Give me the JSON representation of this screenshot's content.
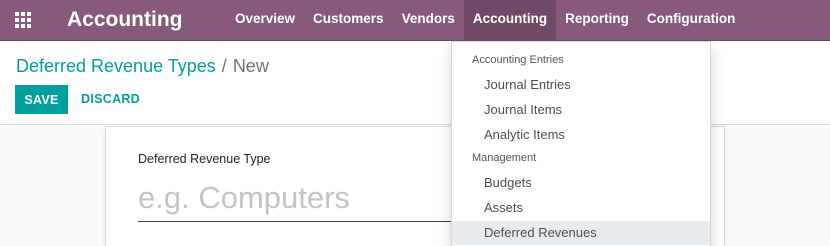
{
  "navbar": {
    "brand": "Accounting",
    "menu": [
      "Overview",
      "Customers",
      "Vendors",
      "Accounting",
      "Reporting",
      "Configuration"
    ]
  },
  "breadcrumb": {
    "parent": "Deferred Revenue Types",
    "separator": "/",
    "current": "New"
  },
  "buttons": {
    "save": "SAVE",
    "discard": "DISCARD"
  },
  "form": {
    "label": "Deferred Revenue Type",
    "placeholder": "e.g. Computers",
    "value": ""
  },
  "dropdown": {
    "section1_header": "Accounting Entries",
    "section1_items": [
      "Journal Entries",
      "Journal Items",
      "Analytic Items"
    ],
    "section2_header": "Management",
    "section2_items": [
      "Budgets",
      "Assets",
      "Deferred Revenues"
    ]
  }
}
